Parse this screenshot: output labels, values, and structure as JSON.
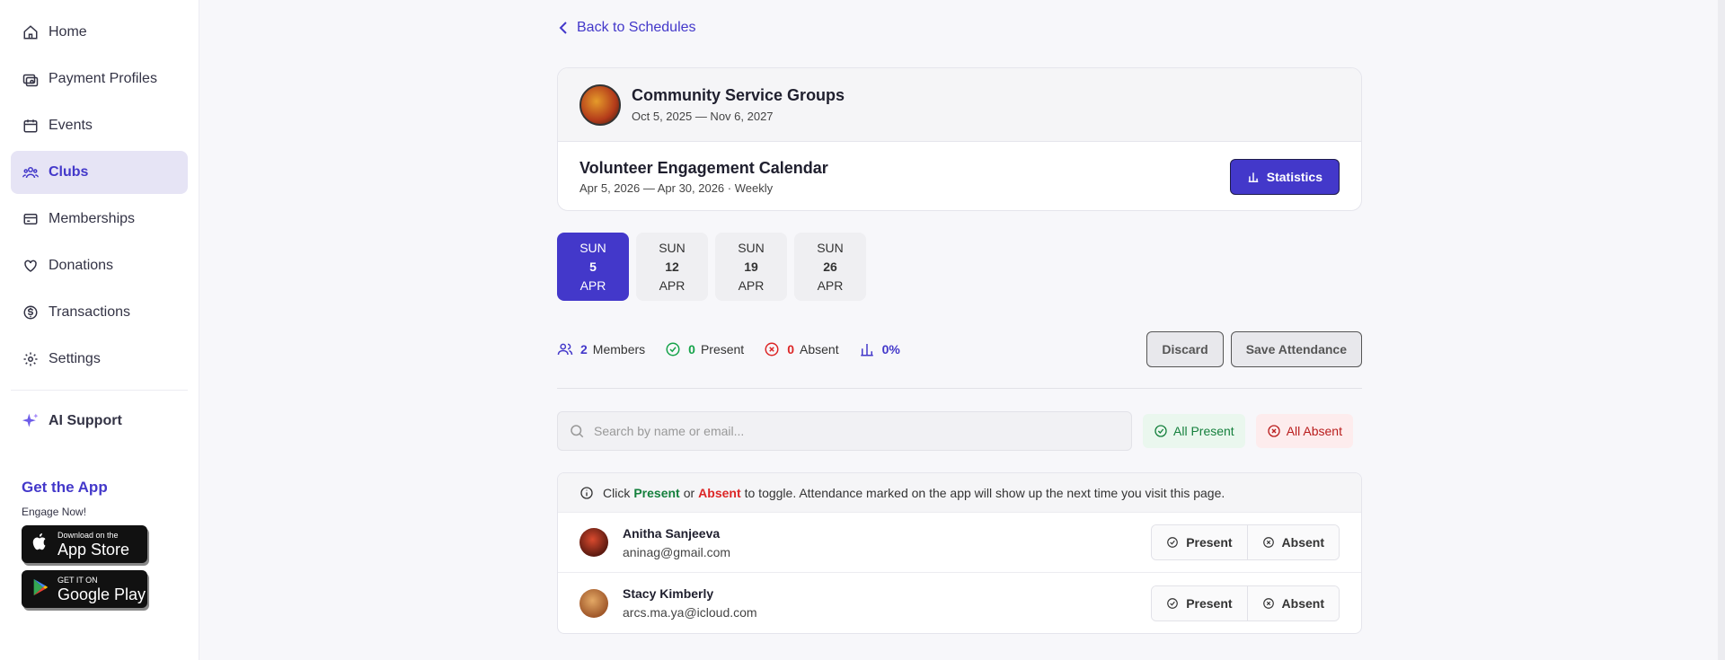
{
  "sidebar": {
    "items": [
      {
        "label": "Home",
        "icon": "home-icon"
      },
      {
        "label": "Payment Profiles",
        "icon": "payment-profiles-icon"
      },
      {
        "label": "Events",
        "icon": "calendar-icon"
      },
      {
        "label": "Clubs",
        "icon": "users-icon",
        "active": true
      },
      {
        "label": "Memberships",
        "icon": "membership-card-icon"
      },
      {
        "label": "Donations",
        "icon": "heart-icon"
      },
      {
        "label": "Transactions",
        "icon": "dollar-icon"
      },
      {
        "label": "Settings",
        "icon": "gear-icon"
      }
    ],
    "ai_support": "AI Support",
    "get_app": {
      "title": "Get the App",
      "subtitle": "Engage Now!",
      "app_store_small": "Download on the",
      "app_store_big": "App Store",
      "google_play_small": "GET IT ON",
      "google_play_big": "Google Play"
    }
  },
  "main": {
    "back_label": "Back to Schedules",
    "group": {
      "name": "Community Service Groups",
      "dates": "Oct 5, 2025 — Nov 6, 2027"
    },
    "calendar": {
      "title": "Volunteer Engagement Calendar",
      "subtitle": "Apr 5, 2026 — Apr 30, 2026 · Weekly"
    },
    "statistics_label": "Statistics",
    "dates": [
      {
        "dow": "SUN",
        "day": "5",
        "month": "APR",
        "selected": true
      },
      {
        "dow": "SUN",
        "day": "12",
        "month": "APR"
      },
      {
        "dow": "SUN",
        "day": "19",
        "month": "APR"
      },
      {
        "dow": "SUN",
        "day": "26",
        "month": "APR"
      }
    ],
    "summary": {
      "members_count": "2",
      "members_label": "Members",
      "present_count": "0",
      "present_label": "Present",
      "absent_count": "0",
      "absent_label": "Absent",
      "rate": "0%"
    },
    "discard_label": "Discard",
    "save_label": "Save Attendance",
    "search_placeholder": "Search by name or email...",
    "all_present_label": "All Present",
    "all_absent_label": "All Absent",
    "info": {
      "pre": "Click",
      "present_word": "Present",
      "or_word": "or",
      "absent_word": "Absent",
      "post": "to toggle. Attendance marked on the app will show up the next time you visit this page."
    },
    "members": [
      {
        "name": "Anitha Sanjeeva",
        "email": "aninag@gmail.com",
        "present_label": "Present",
        "absent_label": "Absent"
      },
      {
        "name": "Stacy Kimberly",
        "email": "arcs.ma.ya@icloud.com",
        "present_label": "Present",
        "absent_label": "Absent"
      }
    ]
  },
  "colors": {
    "accent": "#4338ca",
    "present": "#16a34a",
    "absent": "#dc2626"
  }
}
